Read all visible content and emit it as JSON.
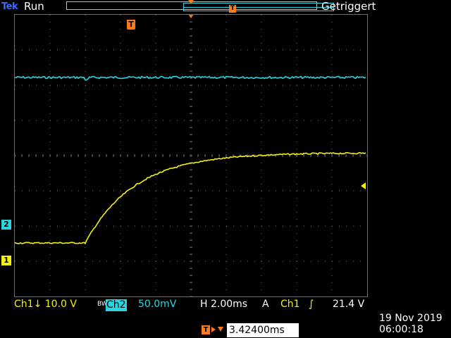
{
  "header": {
    "brand": "Tek",
    "run_state": "Run",
    "trigger_status": "Getriggert"
  },
  "markers": {
    "trigger_marker": "T",
    "record_trigger_marker": "T",
    "ch2_marker": "2",
    "ch1_marker": "1"
  },
  "readout": {
    "ch1_label": "Ch1",
    "ch1_coupling": "↓",
    "ch1_scale": "10.0 V",
    "ch2_bw_limit": "BW",
    "ch2_label": "Ch2",
    "ch2_scale": "50.0mV",
    "h_label": "H",
    "h_scale": "2.00ms",
    "acq_label": "A",
    "trigger_source": "Ch1",
    "trigger_edge": "∫",
    "trigger_level": "21.4 V",
    "trigger_position_icon": "T",
    "trigger_position": "3.42400ms"
  },
  "datetime": {
    "date": "19 Nov 2019",
    "time": "06:00:18"
  },
  "colors": {
    "ch1": "#f2f20a",
    "ch2": "#2ad5e0",
    "trigger": "#ff7a1a",
    "grid": "#6e6e6e"
  },
  "waveforms": {
    "ch1_description": "step response rising at trigger, settling",
    "ch2_description": "flat line with small glitch at trigger"
  }
}
